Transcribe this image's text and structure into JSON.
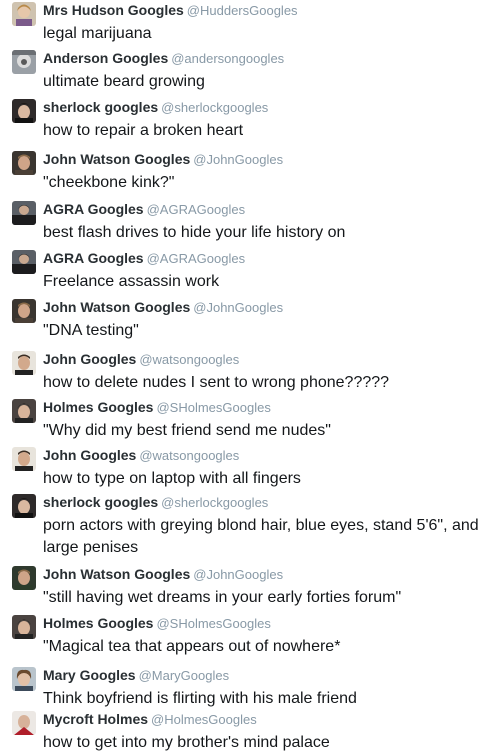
{
  "tweets": [
    {
      "name": "Mrs Hudson Googles",
      "handle": "@HuddersGoogles",
      "text": "legal marijuana",
      "avatar": "mrs-hudson-avatar"
    },
    {
      "name": "Anderson Googles",
      "handle": "@andersongoogles",
      "text": "ultimate beard growing",
      "avatar": "anderson-avatar"
    },
    {
      "name": "sherlock googles",
      "handle": "@sherlockgoogles",
      "text": "how to repair a broken heart",
      "avatar": "sherlock-avatar"
    },
    {
      "name": "John Watson Googles",
      "handle": "@JohnGoogles",
      "text": "\"cheekbone kink?\"",
      "avatar": "john-watson-avatar"
    },
    {
      "name": "AGRA Googles",
      "handle": "@AGRAGoogles",
      "text": "best flash drives to hide your life history on",
      "avatar": "agra-avatar"
    },
    {
      "name": "AGRA Googles",
      "handle": "@AGRAGoogles",
      "text": "Freelance assassin work",
      "avatar": "agra-avatar"
    },
    {
      "name": "John Watson Googles",
      "handle": "@JohnGoogles",
      "text": "\"DNA testing\"",
      "avatar": "john-watson-avatar"
    },
    {
      "name": "John Googles",
      "handle": "@watsongoogles",
      "text": "how to delete nudes I sent to wrong phone?????",
      "avatar": "john-avatar"
    },
    {
      "name": "Holmes Googles",
      "handle": "@SHolmesGoogles",
      "text": "\"Why did my best friend send me nudes\"",
      "avatar": "holmes-avatar"
    },
    {
      "name": "John Googles",
      "handle": "@watsongoogles",
      "text": "how to type on laptop with all fingers",
      "avatar": "john-avatar"
    },
    {
      "name": "sherlock googles",
      "handle": "@sherlockgoogles",
      "text": "porn actors with greying blond hair, blue eyes, stand 5'6\", and large penises",
      "avatar": "sherlock-avatar"
    },
    {
      "name": "John Watson Googles",
      "handle": "@JohnGoogles",
      "text": "\"still having wet dreams in your early forties forum\"",
      "avatar": "john-watson-avatar"
    },
    {
      "name": "Holmes Googles",
      "handle": "@SHolmesGoogles",
      "text": "\"Magical tea that appears out of nowhere*",
      "avatar": "holmes-avatar"
    },
    {
      "name": "Mary Googles",
      "handle": "@MaryGoogles",
      "text": "Think boyfriend is flirting with his male friend",
      "avatar": "mary-avatar"
    },
    {
      "name": "Mycroft Holmes",
      "handle": "@HolmesGoogles",
      "text": "how to get into my brother's mind palace",
      "avatar": "mycroft-avatar"
    }
  ]
}
